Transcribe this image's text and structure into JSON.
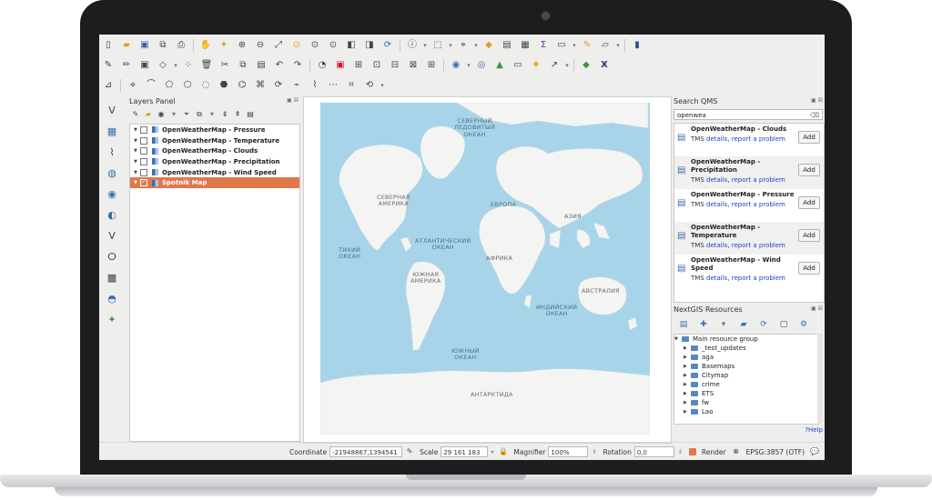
{
  "toolbar1": [
    "new-project-icon",
    "open-icon",
    "save-icon",
    "save-as-icon",
    "print-layout-icon",
    "pan-icon",
    "pan-to-selection-icon",
    "zoom-in-icon",
    "zoom-out-icon",
    "zoom-full-icon",
    "zoom-selection-icon",
    "zoom-layer-icon",
    "zoom-native-icon",
    "zoom-last-icon",
    "zoom-next-icon",
    "refresh-icon",
    "identify-icon",
    "select-icon",
    "measure-icon",
    "annotation-icon",
    "attribute-table-icon",
    "statistics-icon",
    "map-tips-icon",
    "text-annotation-icon",
    "help-icon"
  ],
  "layers_panel": {
    "title": "Layers Panel",
    "layers": [
      {
        "name": "OpenWeatherMap - Pressure"
      },
      {
        "name": "OpenWeatherMap - Temperature"
      },
      {
        "name": "OpenWeatherMap - Clouds"
      },
      {
        "name": "OpenWeatherMap - Precipitation"
      },
      {
        "name": "OpenWeatherMap - Wind Speed"
      },
      {
        "name": "Spotnik Map"
      }
    ]
  },
  "map": {
    "labels": {
      "arctic": "СЕВЕРНЫЙ\nЛЕДОВИТЫЙ\nОКЕАН",
      "north_america": "СЕВЕРНАЯ\nАМЕРИКА",
      "europe": "ЕВРОПА",
      "asia": "АЗИЯ",
      "atlantic": "АТЛАНТИЧЕСКИЙ\nОКЕАН",
      "pacific": "ТИХИЙ\nОКЕАН",
      "africa": "АФРИКА",
      "south_america": "ЮЖНАЯ\nАМЕРИКА",
      "indian": "ИНДИЙСКИЙ\nОКЕАН",
      "australia": "АВСТРАЛИЯ",
      "southern": "ЮЖНЫЙ\nОКЕАН",
      "antarctica": "АНТАРКТИДА"
    }
  },
  "qms": {
    "title": "Search QMS",
    "query": "openwea",
    "results": [
      {
        "name": "OpenWeatherMap - Clouds",
        "type": "TMS",
        "details": "details",
        "report": "report a problem",
        "add": "Add"
      },
      {
        "name": "OpenWeatherMap - Precipitation",
        "type": "TMS",
        "details": "details",
        "report": "report a problem",
        "add": "Add"
      },
      {
        "name": "OpenWeatherMap - Pressure",
        "type": "TMS",
        "details": "details",
        "report": "report a problem",
        "add": "Add"
      },
      {
        "name": "OpenWeatherMap - Temperature",
        "type": "TMS",
        "details": "details",
        "report": "report a problem",
        "add": "Add"
      },
      {
        "name": "OpenWeatherMap - Wind Speed",
        "type": "TMS",
        "details": "details",
        "report": "report a problem",
        "add": "Add"
      }
    ]
  },
  "ngw": {
    "title": "NextGIS Resources",
    "root": "Main resource group",
    "items": [
      "_test_updates",
      "aga",
      "Basemaps",
      "Citymap",
      "crime",
      "ETS",
      "fw",
      "Lao"
    ],
    "help": "?Help"
  },
  "status": {
    "coordinate_label": "Coordinate",
    "coordinate_value": "-21948867,1394541",
    "scale_label": "Scale",
    "scale_value": "29 161 183",
    "magnifier_label": "Magnifier",
    "magnifier_value": "100%",
    "rotation_label": "Rotation",
    "rotation_value": "0,0",
    "render_label": "Render",
    "crs": "EPSG:3857 (OTF)"
  },
  "colors": {
    "accent": "#e0784c",
    "ocean": "#a8d4ea",
    "land": "#f4f4f2",
    "link": "#1b3fd0"
  }
}
